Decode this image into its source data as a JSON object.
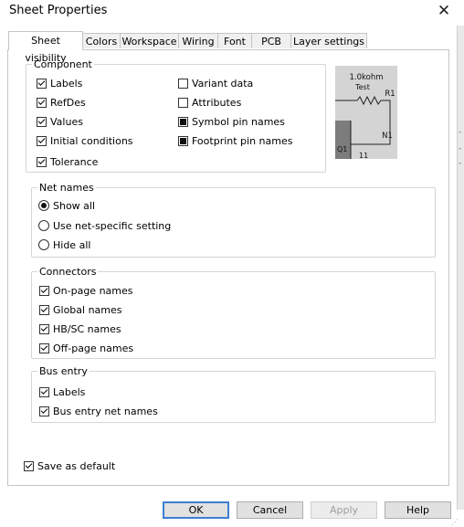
{
  "window": {
    "title": "Sheet Properties"
  },
  "tabs": [
    {
      "label": "Sheet visibility"
    },
    {
      "label": "Colors"
    },
    {
      "label": "Workspace"
    },
    {
      "label": "Wiring"
    },
    {
      "label": "Font"
    },
    {
      "label": "PCB"
    },
    {
      "label": "Layer settings"
    }
  ],
  "component": {
    "legend": "Component",
    "left": [
      {
        "label": "Labels",
        "state": "checked"
      },
      {
        "label": "RefDes",
        "state": "checked"
      },
      {
        "label": "Values",
        "state": "checked"
      },
      {
        "label": "Initial conditions",
        "state": "checked"
      },
      {
        "label": "Tolerance",
        "state": "checked"
      }
    ],
    "right": [
      {
        "label": "Variant data",
        "state": "unchecked"
      },
      {
        "label": "Attributes",
        "state": "unchecked"
      },
      {
        "label": "Symbol pin names",
        "state": "indeterminate"
      },
      {
        "label": "Footprint pin names",
        "state": "indeterminate"
      }
    ]
  },
  "preview": {
    "value": "1.0kohm",
    "tolerance_text": "Test",
    "refdes": "R1",
    "net": "N1",
    "pin_left": "Q1",
    "pin_right": "11"
  },
  "net_names": {
    "legend": "Net names",
    "options": [
      {
        "label": "Show all",
        "selected": true
      },
      {
        "label": "Use net-specific setting",
        "selected": false
      },
      {
        "label": "Hide all",
        "selected": false
      }
    ]
  },
  "connectors": {
    "legend": "Connectors",
    "items": [
      {
        "label": "On-page names",
        "state": "checked"
      },
      {
        "label": "Global names",
        "state": "checked"
      },
      {
        "label": "HB/SC names",
        "state": "checked"
      },
      {
        "label": "Off-page names",
        "state": "checked"
      }
    ]
  },
  "bus_entry": {
    "legend": "Bus entry",
    "items": [
      {
        "label": "Labels",
        "state": "checked"
      },
      {
        "label": "Bus entry net names",
        "state": "checked"
      }
    ]
  },
  "save_default": {
    "label": "Save as default",
    "state": "checked"
  },
  "buttons": {
    "ok": "OK",
    "cancel": "Cancel",
    "apply": "Apply",
    "help": "Help"
  }
}
